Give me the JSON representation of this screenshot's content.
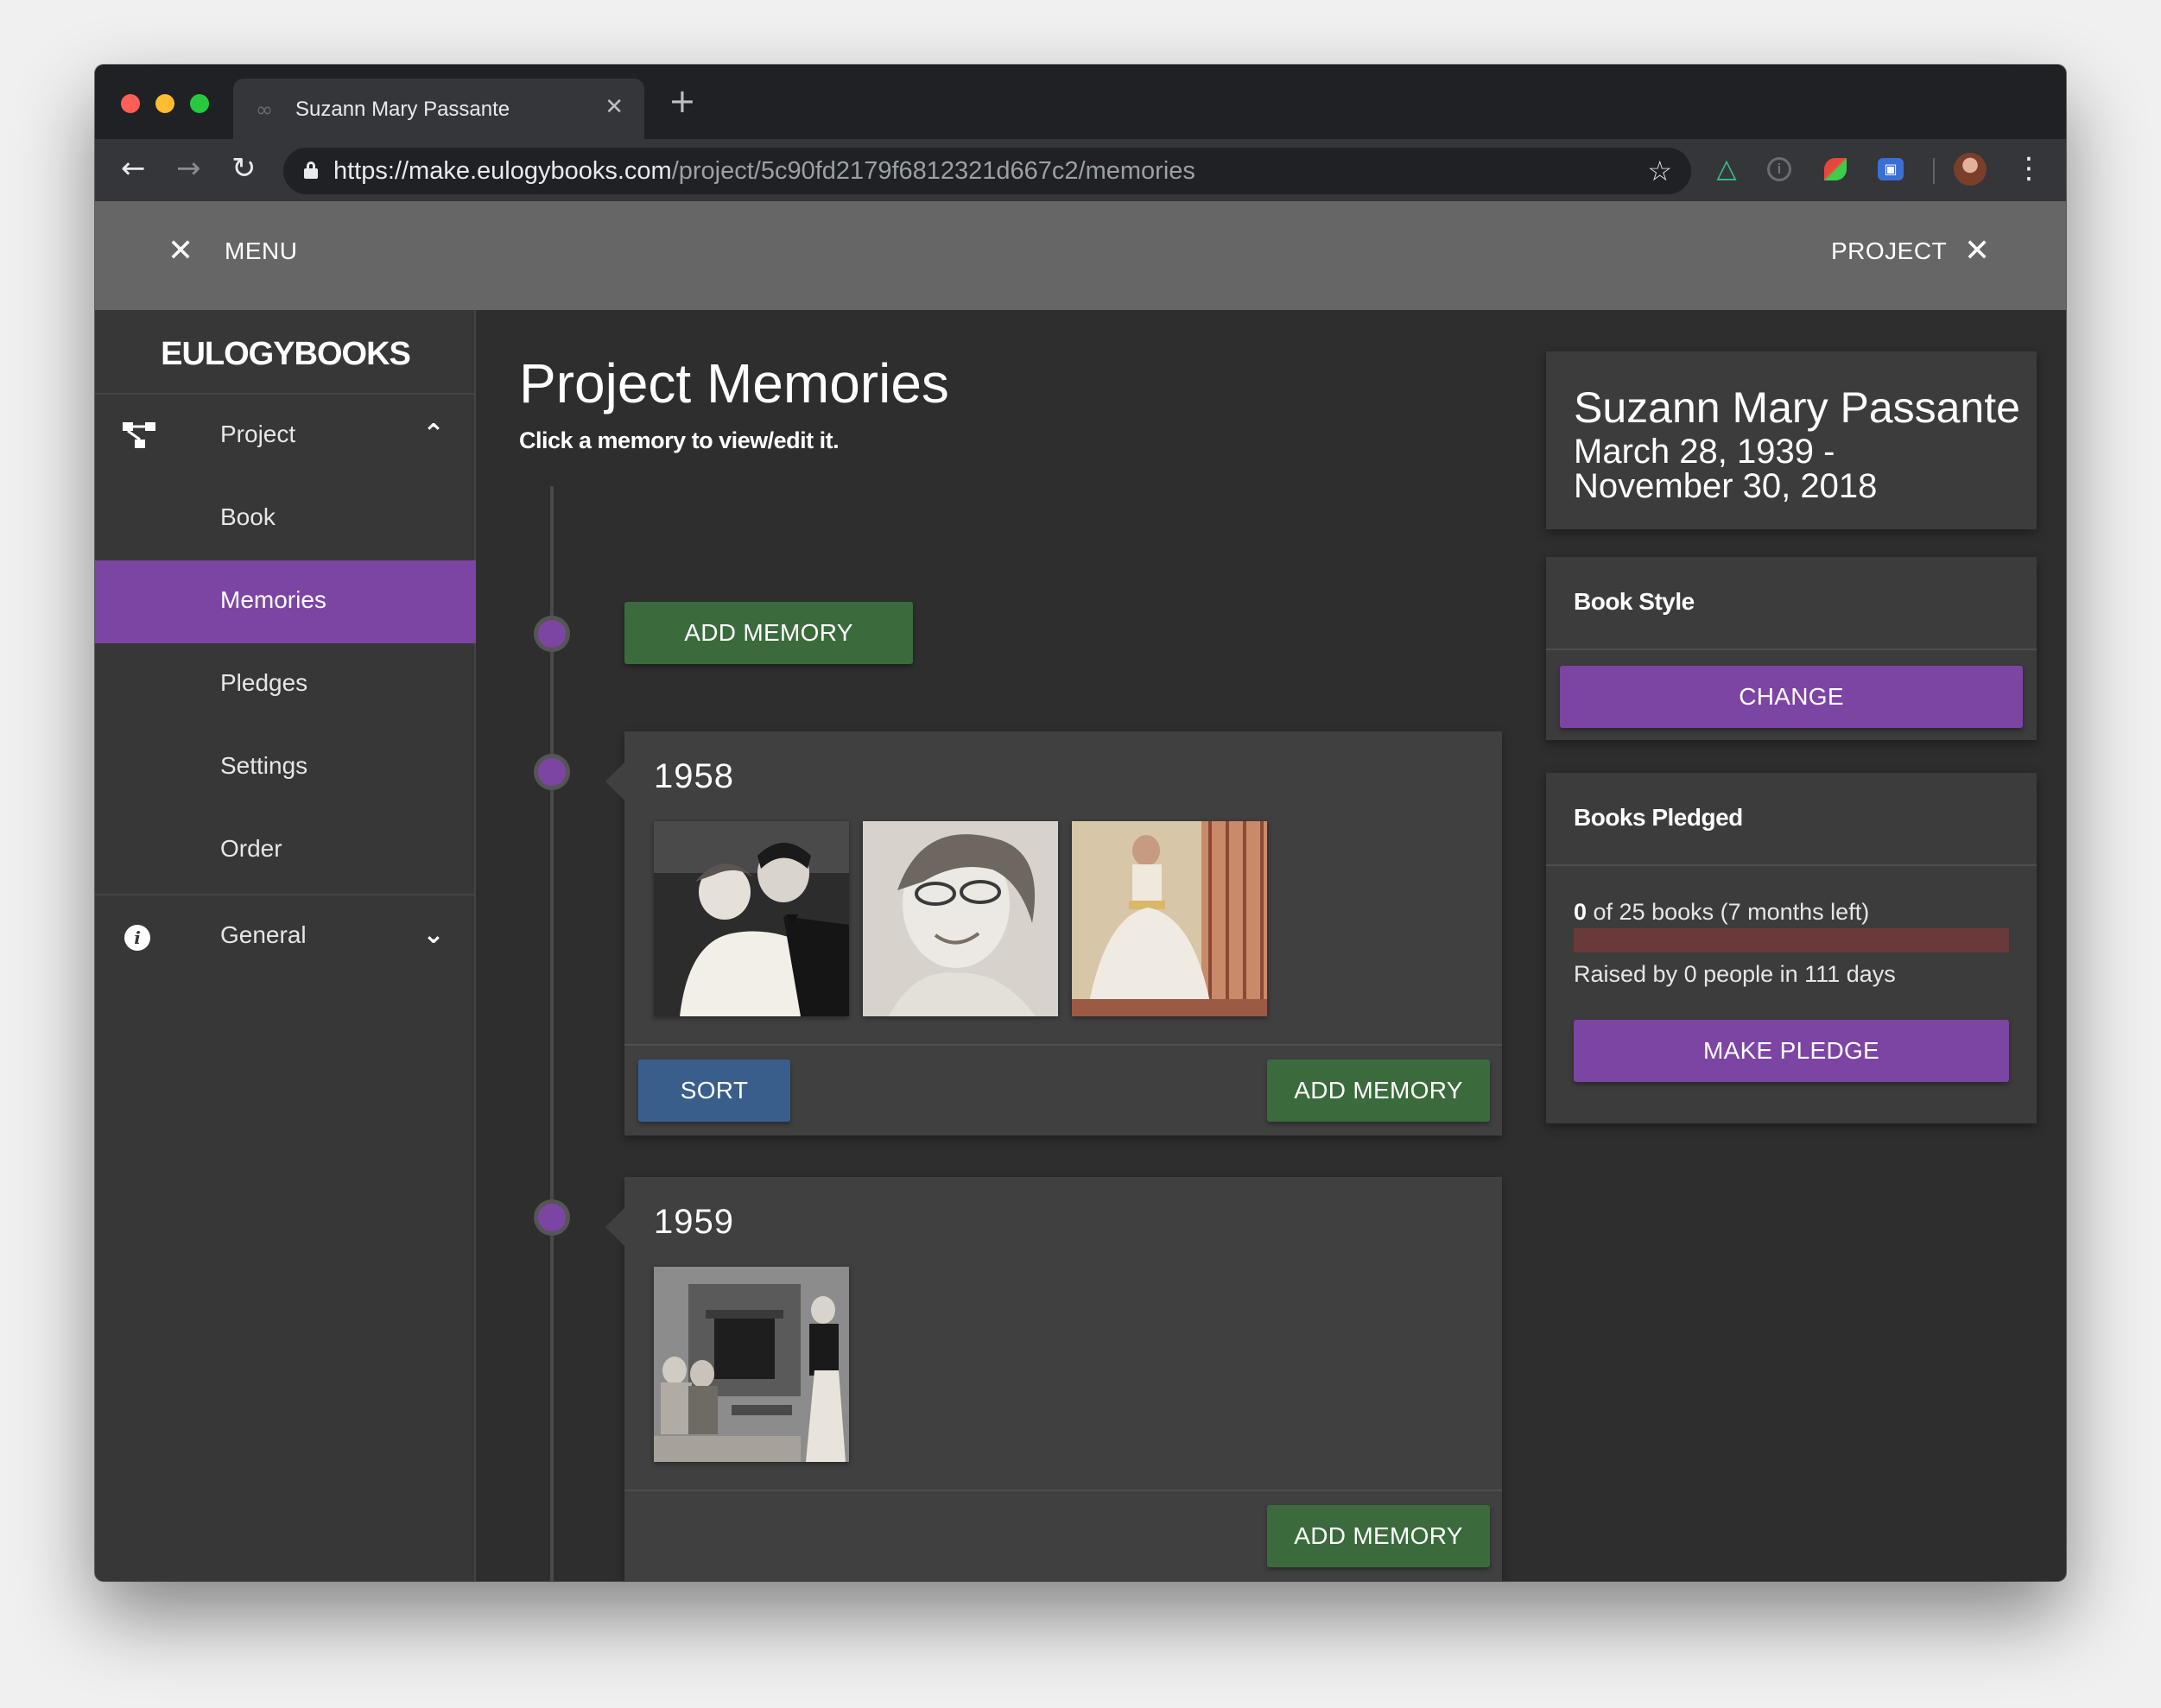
{
  "browser": {
    "tab_title": "Suzann Mary Passante",
    "tab_favicon": "∞",
    "tab_close": "✕",
    "new_tab": "+",
    "url_host": "https://make.eulogybooks.com",
    "url_path": "/project/5c90fd2179f6812321d667c2/memories"
  },
  "appbar": {
    "menu_label": "MENU",
    "project_label": "PROJECT",
    "close_glyph": "✕"
  },
  "sidebar": {
    "logo": "EULOGYBOOKS",
    "project": {
      "label": "Project",
      "icon": "sitemap-icon",
      "expanded": true
    },
    "items": [
      {
        "label": "Book",
        "active": false
      },
      {
        "label": "Memories",
        "active": true
      },
      {
        "label": "Pledges",
        "active": false
      },
      {
        "label": "Settings",
        "active": false
      },
      {
        "label": "Order",
        "active": false
      }
    ],
    "general": {
      "label": "General",
      "icon": "info-icon",
      "expanded": false
    }
  },
  "main": {
    "title": "Project Memories",
    "subtitle": "Click a memory to view/edit it.",
    "top_add_label": "ADD MEMORY",
    "groups": [
      {
        "year": "1958",
        "photos": [
          "couple-dancing-photo",
          "smiling-woman-portrait-photo",
          "woman-in-ballgown-photo"
        ],
        "sort_label": "SORT",
        "add_label": "ADD MEMORY"
      },
      {
        "year": "1959",
        "photos": [
          "living-room-group-photo"
        ],
        "add_label": "ADD MEMORY"
      }
    ]
  },
  "profile": {
    "name": "Suzann Mary Passante",
    "dates_line1": "March 28, 1939 -",
    "dates_line2": "November 30, 2018"
  },
  "book_style": {
    "heading": "Book Style",
    "change_label": "CHANGE"
  },
  "pledges": {
    "heading": "Books Pledged",
    "pledged_count": "0",
    "pledged_rest": " of 25 books (7 months left)",
    "progress_fraction": 0,
    "raised_text": "Raised by 0 people in 111 days",
    "pledge_label": "MAKE PLEDGE"
  },
  "colors": {
    "accent_purple": "#7d45a3",
    "button_green": "#3b6b3d",
    "button_blue": "#3a5e8c"
  }
}
